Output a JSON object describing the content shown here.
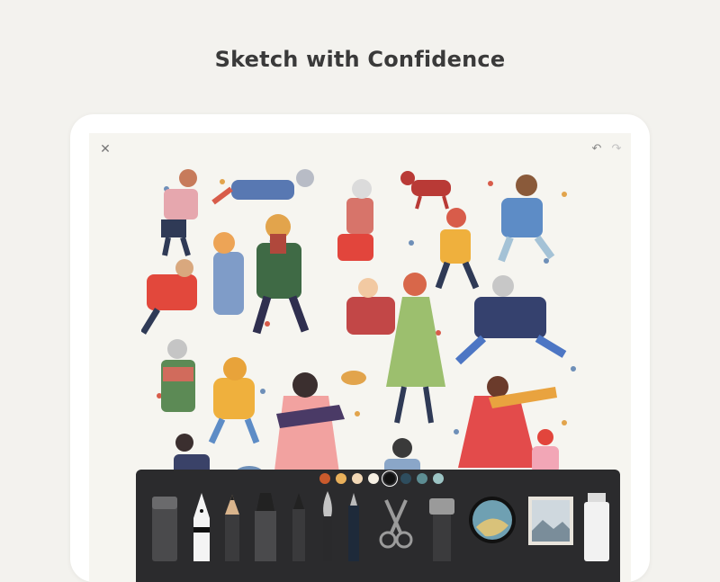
{
  "header": {
    "title": "Sketch with Confidence"
  },
  "toolbar": {
    "close_icon": "close-icon",
    "undo_icon": "undo-icon",
    "redo_icon": "redo-icon"
  },
  "palette": {
    "swatches": [
      "#c95a2c",
      "#e9b05b",
      "#f2d8b6",
      "#f6f0e4",
      "#111111",
      "#2e4d5e",
      "#5d8d93",
      "#9cc4c4"
    ],
    "selected_index": 4,
    "tools": [
      "eraser",
      "fountain-pen",
      "pencil",
      "marker",
      "felt-pen",
      "brush",
      "fine-liner",
      "scissors",
      "ruler",
      "color-mixer",
      "image-import",
      "roller"
    ]
  },
  "colors": {
    "background": "#f3f2ee",
    "canvas": "#f6f5f0",
    "toolbar": "#2b2b2d"
  }
}
